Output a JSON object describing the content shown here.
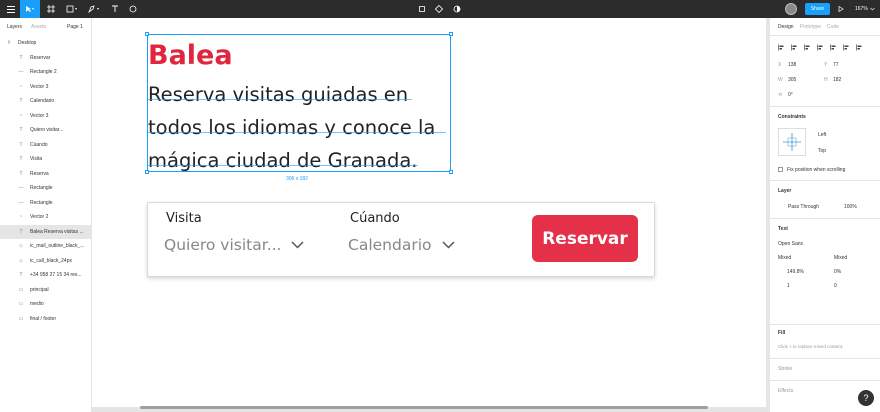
{
  "toolbar": {
    "share_label": "Share",
    "zoom_label": "167%",
    "tools": [
      "move-tool",
      "frame-tool",
      "shape-tool",
      "pen-tool",
      "text-tool",
      "comment-tool"
    ]
  },
  "left_panel": {
    "tabs": {
      "layers": "Layers",
      "assets": "Assets",
      "page": "Page 1"
    },
    "layers": [
      {
        "name": "Desktop",
        "icon": "frame-icon"
      },
      {
        "name": "Reservar",
        "icon": "text-icon"
      },
      {
        "name": "Rectangle 2",
        "icon": "rect-icon"
      },
      {
        "name": "Vector 3",
        "icon": "vector-icon"
      },
      {
        "name": "Calendario",
        "icon": "text-icon"
      },
      {
        "name": "Vector 3",
        "icon": "vector-icon"
      },
      {
        "name": "Quiero visitar...",
        "icon": "text-icon"
      },
      {
        "name": "Cúando",
        "icon": "text-icon"
      },
      {
        "name": "Visita",
        "icon": "text-icon"
      },
      {
        "name": "Reserva",
        "icon": "text-icon"
      },
      {
        "name": "Rectangle",
        "icon": "rect-icon"
      },
      {
        "name": "Rectangle",
        "icon": "rect-icon"
      },
      {
        "name": "Vector 2",
        "icon": "vector-icon"
      },
      {
        "name": "Balea Reserva visitas ...",
        "icon": "text-icon"
      },
      {
        "name": "ic_mail_outline_black_...",
        "icon": "component-icon"
      },
      {
        "name": "ic_call_black_24px",
        "icon": "component-icon"
      },
      {
        "name": "+34 958 27 15 34 res...",
        "icon": "text-icon"
      },
      {
        "name": "principal",
        "icon": "group-icon"
      },
      {
        "name": "medio",
        "icon": "group-icon"
      },
      {
        "name": "final / footer",
        "icon": "group-icon"
      }
    ]
  },
  "canvas": {
    "title": "Balea",
    "paragraph_lines": [
      "Reserva visitas guiadas en",
      "todos los idiomas y conoce la",
      "mágica ciudad de Granada."
    ],
    "selection_size": "306 x 182",
    "card": {
      "visita_label": "Visita",
      "visita_value": "Quiero visitar...",
      "cuando_label": "Cúando",
      "cuando_value": "Calendario",
      "button": "Reservar"
    }
  },
  "right_panel": {
    "tabs": {
      "design": "Design",
      "prototype": "Prototype",
      "code": "Code"
    },
    "x": "138",
    "y": "77",
    "w": "305",
    "h": "182",
    "rotation": "0°",
    "constraints_title": "Constraints",
    "constraint_h": "Left",
    "constraint_v": "Top",
    "fix_position": "Fix position when scrolling",
    "layer_title": "Layer",
    "blend": "Pass Through",
    "opacity": "100%",
    "text_title": "Text",
    "font": "Open Sans",
    "weight": "Mixed",
    "size": "Mixed",
    "line_height": "149.8%",
    "letter_spacing": "0%",
    "paragraph_spacing": "1",
    "para_indent": "0",
    "fill_title": "Fill",
    "fill_hint": "Click + to replace mixed content.",
    "stroke_title": "Stroke",
    "effects_title": "Effects"
  },
  "colors": {
    "accent": "#18a0fb",
    "brand_red": "#e0263f",
    "button_red": "#e5304a",
    "toolbar": "#2c2c2c"
  }
}
